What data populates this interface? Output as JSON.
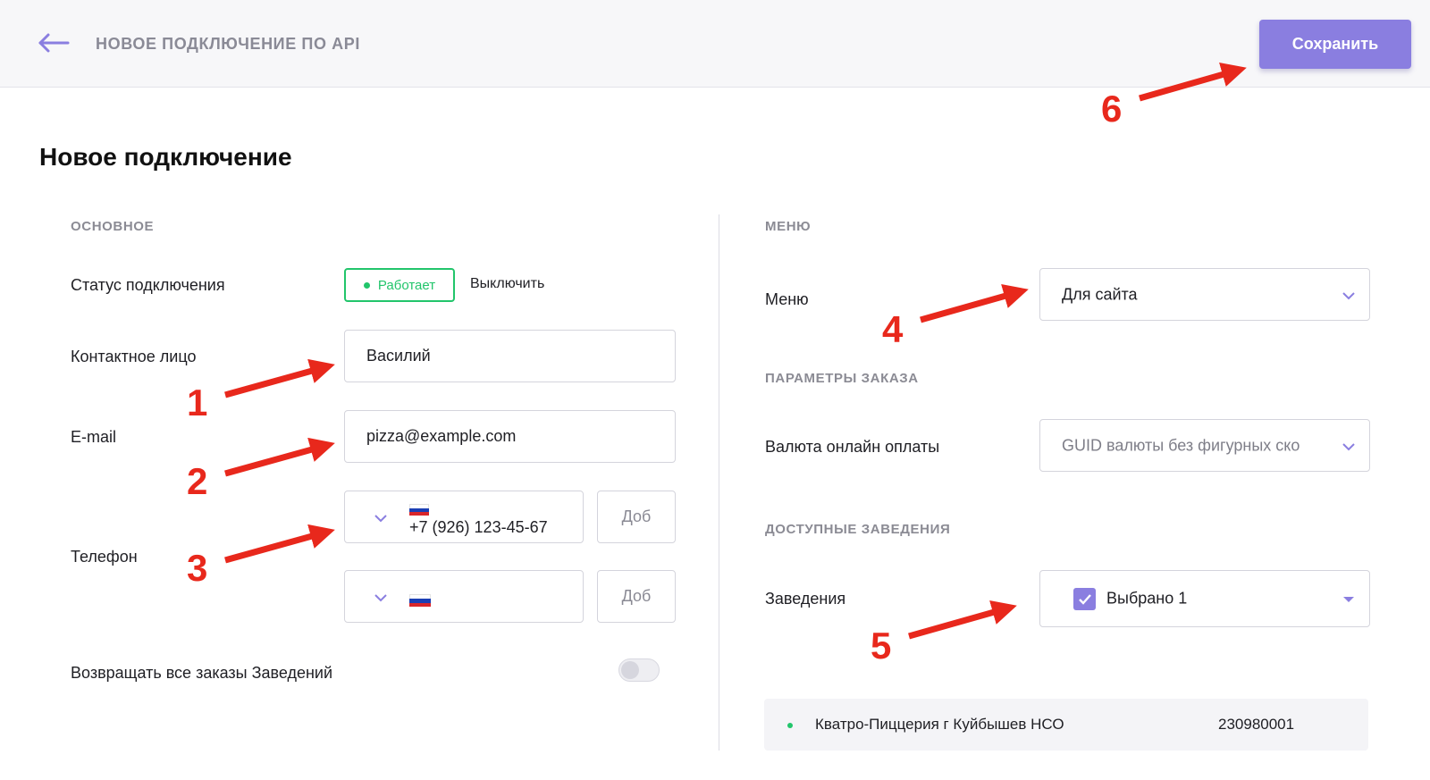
{
  "header": {
    "back_icon": "arrow-left-icon",
    "title": "НОВОЕ ПОДКЛЮЧЕНИЕ ПО API",
    "save_label": "Сохранить"
  },
  "page": {
    "title": "Новое подключение"
  },
  "basic": {
    "section_title": "ОСНОВНОЕ",
    "status_label": "Статус подключения",
    "status_value": "Работает",
    "disable_link": "Выключить",
    "contact_label": "Контактное лицо",
    "contact_value": "Василий",
    "email_label": "E-mail",
    "email_value": "pizza@example.com",
    "phone_label": "Телефон",
    "phones": [
      {
        "number": "+7 (926) 123-45-67",
        "ext_placeholder": "Доб"
      },
      {
        "number": "",
        "ext_placeholder": "Доб"
      }
    ],
    "return_orders_label": "Возвращать все заказы Заведений"
  },
  "menu": {
    "section_title": "МЕНЮ",
    "menu_label": "Меню",
    "menu_value": "Для сайта"
  },
  "order_params": {
    "section_title": "ПАРАМЕТРЫ ЗАКАЗА",
    "currency_label": "Валюта онлайн оплаты",
    "currency_value": "GUID валюты без фигурных ско"
  },
  "venues": {
    "section_title": "ДОСТУПНЫЕ ЗАВЕДЕНИЯ",
    "venues_label": "Заведения",
    "selected_text": "Выбрано 1",
    "items": [
      {
        "name": "Кватро-Пиццерия г Куйбышев НСО",
        "id": "230980001"
      }
    ]
  },
  "annotations": [
    "1",
    "2",
    "3",
    "4",
    "5",
    "6"
  ],
  "colors": {
    "accent": "#8a7ee0",
    "status_green": "#22c56b",
    "annotation_red": "#e8281c"
  }
}
